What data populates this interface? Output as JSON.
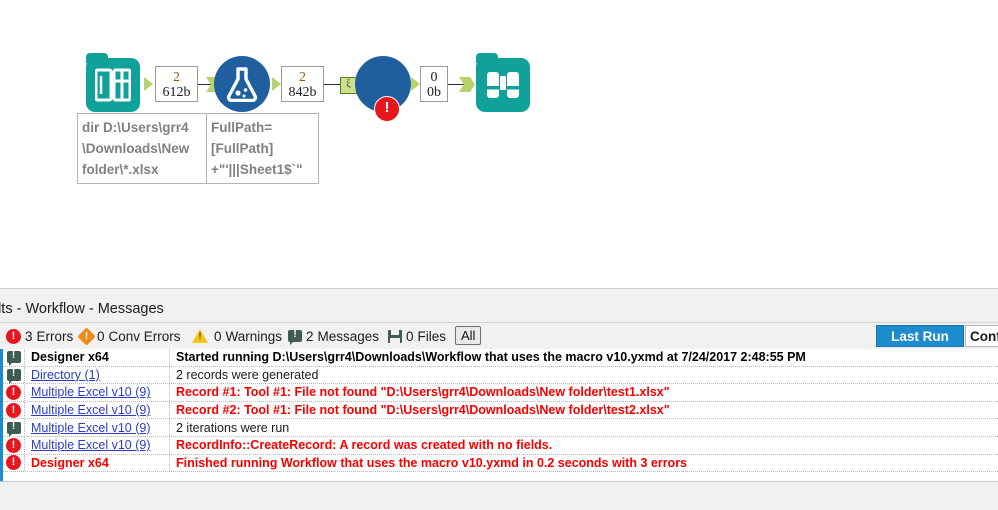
{
  "canvas": {
    "tools": [
      {
        "name": "directory-tool",
        "icon": "directory-icon",
        "label": "Directory"
      },
      {
        "name": "formula-tool",
        "icon": "flask-icon",
        "label": "Formula"
      },
      {
        "name": "macro-tool",
        "icon": "macro-circle-icon",
        "label": "Multiple Excel v10",
        "badge": "!"
      },
      {
        "name": "browse-tool",
        "icon": "binoculars-icon",
        "label": "Browse"
      }
    ],
    "record_boxes": [
      {
        "count": "2",
        "size": "612b"
      },
      {
        "count": "2",
        "size": "842b"
      },
      {
        "count": "0",
        "size": "0b"
      }
    ],
    "annotations": [
      {
        "name": "directory-annotation",
        "text": "dir D:\\Users\\grr4\n\\Downloads\\New\nfolder\\*.xlsx"
      },
      {
        "name": "formula-annotation",
        "text": "FullPath=\n[FullPath]\n+\"'|||Sheet1$`\""
      }
    ],
    "macro_anchor_glyph": "ξ"
  },
  "results": {
    "title": "ults - Workflow - Messages",
    "toolbar": {
      "errors": {
        "count": "3",
        "label": "Errors",
        "icon": "error-icon",
        "color": "#e8151d"
      },
      "conv_errors": {
        "count": "0",
        "label": "Conv Errors",
        "icon": "conv-error-icon",
        "color": "#f08a1a"
      },
      "warnings": {
        "count": "0",
        "label": "Warnings",
        "icon": "warning-icon",
        "color": "#f5c518"
      },
      "messages": {
        "count": "2",
        "label": "Messages",
        "icon": "message-icon",
        "color": "#3e5c52"
      },
      "files": {
        "count": "0",
        "label": "Files",
        "icon": "file-icon",
        "color": "#3e5c52"
      },
      "filter_all": "All",
      "last_run": "Last Run",
      "config": "Conf",
      "accent": "#1c8ccc"
    },
    "rows": [
      {
        "icon": "message-icon",
        "tool": "Designer x64",
        "tool_style": "bold",
        "message": "Started running D:\\Users\\grr4\\Downloads\\Workflow that uses the macro v10.yxmd at 7/24/2017 2:48:55 PM",
        "message_style": "bold"
      },
      {
        "icon": "message-icon",
        "tool": "Directory (1)",
        "tool_style": "link",
        "message": "2 records were generated",
        "message_style": "plain"
      },
      {
        "icon": "error-icon",
        "tool": "Multiple Excel v10 (9)",
        "tool_style": "link",
        "message": "Record #1: Tool #1: File not found \"D:\\Users\\grr4\\Downloads\\New folder\\test1.xlsx\"",
        "message_style": "error"
      },
      {
        "icon": "error-icon",
        "tool": "Multiple Excel v10 (9)",
        "tool_style": "link",
        "message": "Record #2: Tool #1: File not found \"D:\\Users\\grr4\\Downloads\\New folder\\test2.xlsx\"",
        "message_style": "error"
      },
      {
        "icon": "message-icon",
        "tool": "Multiple Excel v10 (9)",
        "tool_style": "link",
        "message": "2 iterations were run",
        "message_style": "plain"
      },
      {
        "icon": "error-icon",
        "tool": "Multiple Excel v10 (9)",
        "tool_style": "link",
        "message": "RecordInfo::CreateRecord:  A record was created with no fields.",
        "message_style": "error"
      },
      {
        "icon": "error-icon",
        "tool": "Designer x64",
        "tool_style": "error",
        "message": "Finished running Workflow that uses the macro v10.yxmd in 0.2 seconds with 3 errors",
        "message_style": "error"
      }
    ]
  }
}
